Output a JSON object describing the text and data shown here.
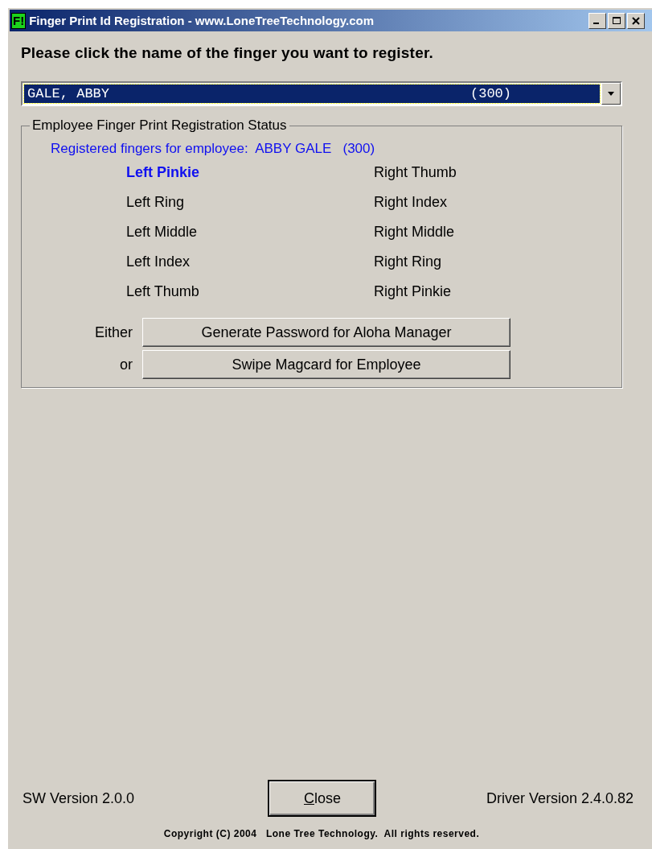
{
  "window": {
    "title": "Finger Print Id Registration - www.LoneTreeTechnology.com",
    "app_icon": "F!"
  },
  "instruction": "Please click the name of the finger you want to register.",
  "employee_combo": {
    "name": "GALE, ABBY",
    "number": "(300)"
  },
  "status_group": {
    "title": "Employee Finger Print Registration Status",
    "registered_label": "Registered fingers for employee:  ABBY GALE   (300)",
    "left_fingers": [
      {
        "label": "Left Pinkie",
        "registered": true
      },
      {
        "label": "Left Ring",
        "registered": false
      },
      {
        "label": "Left Middle",
        "registered": false
      },
      {
        "label": "Left Index",
        "registered": false
      },
      {
        "label": "Left Thumb",
        "registered": false
      }
    ],
    "right_fingers": [
      {
        "label": "Right Thumb",
        "registered": false
      },
      {
        "label": "Right Index",
        "registered": false
      },
      {
        "label": "Right Middle",
        "registered": false
      },
      {
        "label": "Right Ring",
        "registered": false
      },
      {
        "label": "Right Pinkie",
        "registered": false
      }
    ],
    "options": [
      {
        "prefix": "Either",
        "button": "Generate Password for Aloha Manager"
      },
      {
        "prefix": "or",
        "button": "Swipe Magcard for Employee"
      }
    ]
  },
  "footer": {
    "sw_version": "SW Version 2.0.0",
    "close_button": "Close",
    "driver_version": "Driver Version 2.4.0.82",
    "copyright": "Copyright (C) 2004   Lone Tree Technology.  All rights reserved."
  }
}
